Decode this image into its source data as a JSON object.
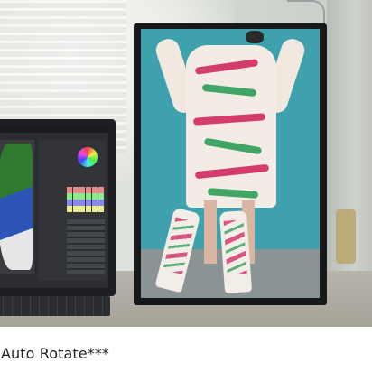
{
  "photo": {
    "subject": "laptop-and-rotated-monitor",
    "accent_screen_color": "#3fa1ad"
  },
  "caption": {
    "text": "Auto Rotate***"
  }
}
